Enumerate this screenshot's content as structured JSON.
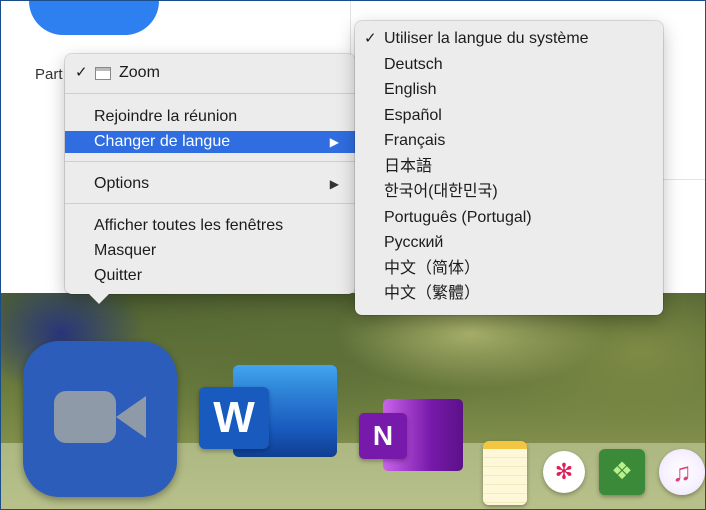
{
  "background_window": {
    "partial_label": "Part"
  },
  "context_menu": {
    "app_item": {
      "check": "✓",
      "label": "Zoom"
    },
    "join_meeting": "Rejoindre la réunion",
    "change_language": "Changer de langue",
    "options": "Options",
    "show_all_windows": "Afficher toutes les fenêtres",
    "hide": "Masquer",
    "quit": "Quitter",
    "submenu_arrow": "▶"
  },
  "language_submenu": {
    "items": [
      {
        "label": "Utiliser la langue du système",
        "checked": "✓"
      },
      {
        "label": "Deutsch",
        "checked": ""
      },
      {
        "label": "English",
        "checked": ""
      },
      {
        "label": "Español",
        "checked": ""
      },
      {
        "label": "Français",
        "checked": ""
      },
      {
        "label": "日本語",
        "checked": ""
      },
      {
        "label": "한국어(대한민국)",
        "checked": ""
      },
      {
        "label": "Português (Portugal)",
        "checked": ""
      },
      {
        "label": "Русский",
        "checked": ""
      },
      {
        "label": "中文（简体）",
        "checked": ""
      },
      {
        "label": "中文（繁體）",
        "checked": ""
      }
    ]
  },
  "dock": {
    "word_letter": "W",
    "onenote_letter": "N"
  },
  "colors": {
    "menu_highlight": "#2f6de0",
    "zoom_blue": "#2d5dba",
    "word_blue": "#185abd",
    "onenote_purple": "#7719aa"
  }
}
